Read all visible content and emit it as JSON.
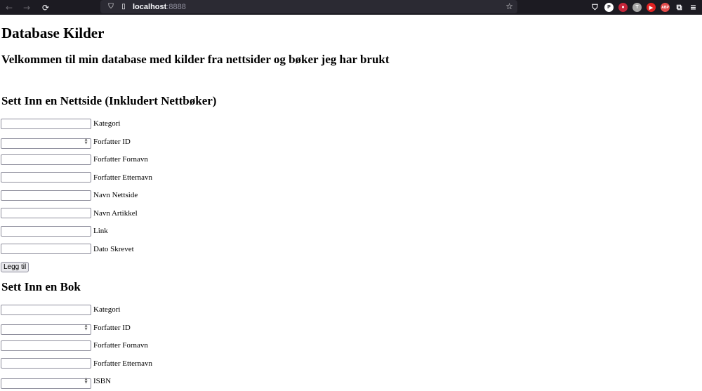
{
  "browser": {
    "back_icon": "←",
    "forward_icon": "→",
    "reload_icon": "⟳",
    "url_host": "localhost",
    "url_port": ":8888",
    "bookmark_icon": "☆",
    "extensions": [
      {
        "name": "pocket-icon",
        "glyph": "⛉",
        "color": "#2b2a33"
      },
      {
        "name": "profile-icon",
        "glyph": "P",
        "color": "#ffffff"
      },
      {
        "name": "record-icon",
        "glyph": "●",
        "color": "#c5253a"
      },
      {
        "name": "translate-icon",
        "glyph": "T",
        "color": "#a6a6a6"
      },
      {
        "name": "youtube-icon",
        "glyph": "▶",
        "color": "#e22222"
      },
      {
        "name": "adblock-icon",
        "glyph": "ABP",
        "color": "#e34b4b"
      },
      {
        "name": "extensions-icon",
        "glyph": "⧉",
        "color": "#2b2a33"
      },
      {
        "name": "menu-icon",
        "glyph": "≡",
        "color": "#2b2a33"
      }
    ]
  },
  "page": {
    "title": "Database Kilder",
    "welcome": "Velkommen til min database med kilder fra nettsider og bøker jeg har brukt",
    "website_section": {
      "heading": "Sett Inn en Nettside (Inkludert Nettbøker)",
      "fields": [
        {
          "label": "Kategori",
          "type": "text"
        },
        {
          "label": "Forfatter ID",
          "type": "number"
        },
        {
          "label": "Forfatter Fornavn",
          "type": "text"
        },
        {
          "label": "Forfatter Etternavn",
          "type": "text"
        },
        {
          "label": "Navn Nettside",
          "type": "text"
        },
        {
          "label": "Navn Artikkel",
          "type": "text"
        },
        {
          "label": "Link",
          "type": "text"
        },
        {
          "label": "Dato Skrevet",
          "type": "text"
        }
      ],
      "submit_label": "Legg til"
    },
    "book_section": {
      "heading": "Sett Inn en Bok",
      "fields": [
        {
          "label": "Kategori",
          "type": "text"
        },
        {
          "label": "Forfatter ID",
          "type": "number"
        },
        {
          "label": "Forfatter Fornavn",
          "type": "text"
        },
        {
          "label": "Forfatter Etternavn",
          "type": "text"
        },
        {
          "label": "ISBN",
          "type": "number"
        }
      ]
    }
  }
}
